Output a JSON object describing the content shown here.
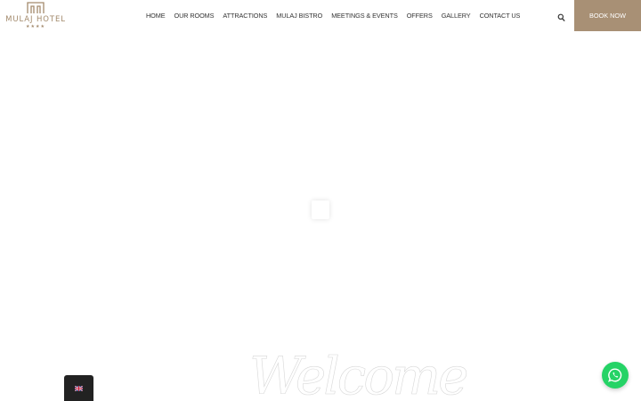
{
  "header": {
    "logo_text": "MULAJ HOTEL",
    "logo_stars": "★★★★",
    "brand_color": "#a38a6c",
    "nav": [
      {
        "label": "HOME"
      },
      {
        "label": "OUR ROOMS"
      },
      {
        "label": "ATTRACTIONS"
      },
      {
        "label": "MULAJ BISTRO"
      },
      {
        "label": "MEETINGS & EVENTS"
      },
      {
        "label": "OFFERS"
      },
      {
        "label": "GALLERY"
      },
      {
        "label": "CONTACT US"
      }
    ],
    "search_icon": "search-icon",
    "book_label": "BOOK NOW",
    "book_color": "#a89075"
  },
  "hero": {
    "welcome_text": "Welcome",
    "loader_icon": "loading-spinner"
  },
  "floating": {
    "language_flag": "uk-flag-icon",
    "whatsapp_icon": "whatsapp-icon",
    "whatsapp_color": "#25d366"
  }
}
